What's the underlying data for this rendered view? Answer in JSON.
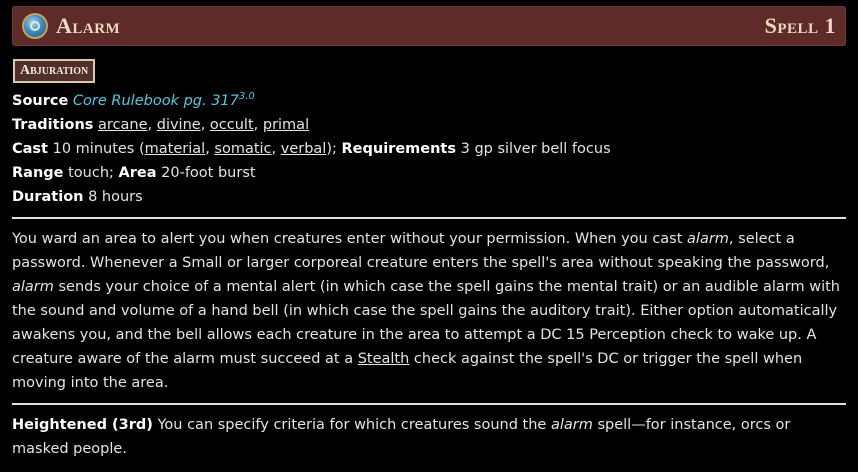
{
  "header": {
    "title": "Alarm",
    "level": "Spell 1"
  },
  "trait": "Abjuration",
  "source": {
    "label": "Source",
    "book": "Core Rulebook pg. 317",
    "version": "3.0"
  },
  "traditions": {
    "label": "Traditions",
    "items": [
      "arcane",
      "divine",
      "occult",
      "primal"
    ]
  },
  "cast": {
    "label": "Cast",
    "time": "10 minutes",
    "components": [
      "material",
      "somatic",
      "verbal"
    ],
    "req_label": "Requirements",
    "requirements": "3 gp silver bell focus"
  },
  "range": {
    "label": "Range",
    "value": "touch",
    "area_label": "Area",
    "area": "20-foot burst"
  },
  "duration": {
    "label": "Duration",
    "value": "8 hours"
  },
  "description": {
    "p1": "You ward an area to alert you when creatures enter without your permission. When you cast ",
    "em1": "alarm",
    "p2": ", select a password. Whenever a Small or larger corporeal creature enters the spell's area without speaking the password, ",
    "em2": "alarm",
    "p3": " sends your choice of a mental alert (in which case the spell gains the mental trait) or an audible alarm with the sound and volume of a hand bell (in which case the spell gains the auditory trait). Either option automatically awakens you, and the bell allows each creature in the area to attempt a DC 15 Perception check to wake up. A creature aware of the alarm must succeed at a ",
    "link": "Stealth",
    "p4": " check against the spell's DC or trigger the spell when moving into the area."
  },
  "heightened": {
    "label": "Heightened (3rd)",
    "t1": " You can specify criteria for which creatures sound the ",
    "em": "alarm",
    "t2": " spell—for instance, orcs or masked people."
  },
  "colors": {
    "header_bg": "#5f2b28",
    "link": "#4ec9e5",
    "trait_bg": "#522e2c"
  },
  "icons": {
    "spell": "spell-school-icon"
  }
}
